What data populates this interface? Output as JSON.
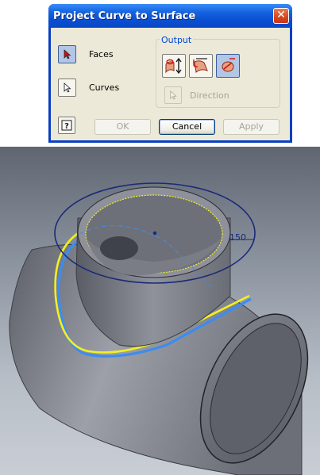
{
  "dialog": {
    "title": "Project Curve to Surface",
    "close_icon": "close-icon",
    "selectors": [
      {
        "label": "Faces",
        "icon": "select-arrow-icon",
        "pressed": true
      },
      {
        "label": "Curves",
        "icon": "select-arrow-icon",
        "pressed": false
      }
    ],
    "output": {
      "title": "Output",
      "options": [
        {
          "icon": "project-along-vector-icon",
          "pressed": false
        },
        {
          "icon": "project-to-closest-point-icon",
          "pressed": false
        },
        {
          "icon": "wrap-to-surface-icon",
          "pressed": true
        }
      ],
      "direction_label": "Direction",
      "direction_enabled": false
    },
    "buttons": {
      "help_icon": "help-icon",
      "ok": "OK",
      "cancel": "Cancel",
      "apply": "Apply"
    }
  },
  "viewport": {
    "dimension_value": "150",
    "colors": {
      "background_top": "#5f6672",
      "body": "#8d9098",
      "sketch_circle": "#1a2a78",
      "projected_curve": "#f2f020",
      "highlight_edge": "#3c8cf0"
    }
  }
}
